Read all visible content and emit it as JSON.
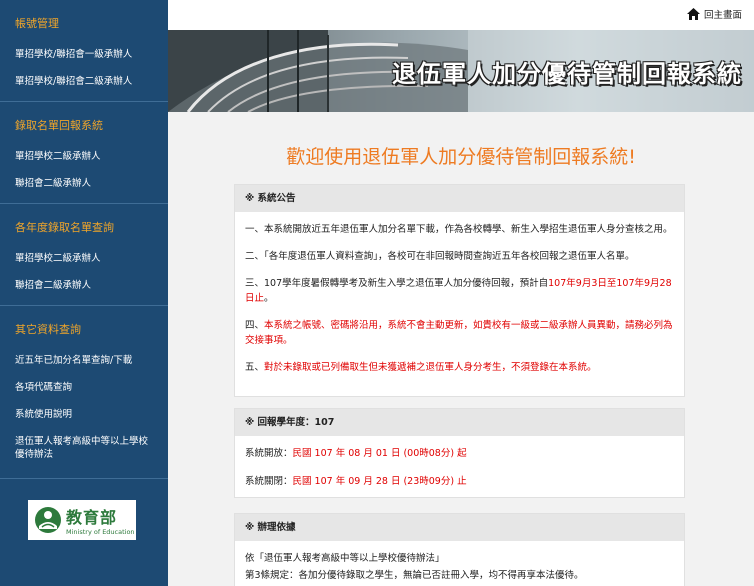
{
  "sidebar": {
    "sections": [
      {
        "title": "帳號管理",
        "items": [
          "單招學校/聯招會一級承辦人",
          "單招學校/聯招會二級承辦人"
        ]
      },
      {
        "title": "錄取名單回報系統",
        "items": [
          "單招學校二級承辦人",
          "聯招會二級承辦人"
        ]
      },
      {
        "title": "各年度錄取名單查詢",
        "items": [
          "單招學校二級承辦人",
          "聯招會二級承辦人"
        ]
      },
      {
        "title": "其它資料查詢",
        "items": [
          "近五年已加分名單查詢/下載",
          "各項代碼查詢",
          "系統使用說明",
          "退伍軍人報考高級中等以上學校優待辦法"
        ]
      }
    ],
    "logo_cn": "教育部",
    "logo_en": "Ministry of Education"
  },
  "topbar": {
    "home_label": "回主畫面"
  },
  "banner": {
    "title": "退伍軍人加分優待管制回報系統"
  },
  "welcome": "歡迎使用退伍軍人加分優待管制回報系統!",
  "announce": {
    "title": "※ 系統公告",
    "item1": "一、本系統開放近五年退伍軍人加分名單下載，作為各校轉學、新生入學招生退伍軍人身分查核之用。",
    "item2": "二、「各年度退伍軍人資料查詢」，各校可在非回報時間查詢近五年各校回報之退伍軍人名單。",
    "item3_pre": "三、107學年度暑假轉學考及新生入學之退伍軍人加分優待回報，預計自",
    "item3_red": "107年9月3日至107年9月28日止",
    "item3_post": "。",
    "item4_pre": "四、",
    "item4_red": "本系統之帳號、密碼將沿用，系統不會主動更新，如貴校有一級或二級承辦人員異動，請務必列為交接事項。",
    "item5_pre": "五、",
    "item5_red": "對於未錄取或已列備取生但未獲遞補之退伍軍人身分考生，不須登錄在本系統。"
  },
  "year": {
    "title": "※ 回報學年度：107",
    "open_label": "系統開放：",
    "open_value": "民國 107 年 08 月 01 日 (00時08分) 起",
    "close_label": "系統關閉：",
    "close_value": "民國 107 年 09 月 28 日 (23時09分) 止"
  },
  "law": {
    "title": "※ 辦理依據",
    "line1": "依「退伍軍人報考高級中等以上學校優待辦法」",
    "line2": "第3條規定：各加分優待錄取之學生，無論已否註冊入學，均不得再享本法優待。"
  }
}
